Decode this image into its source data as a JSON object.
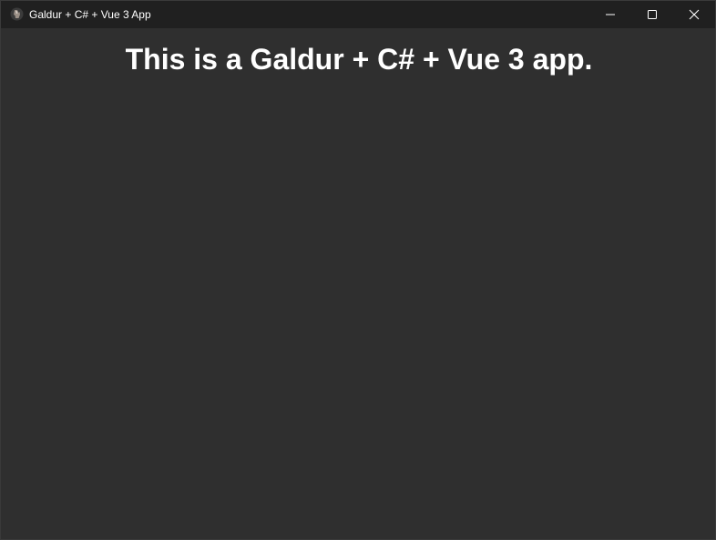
{
  "window": {
    "title": "Galdur + C# + Vue 3 App",
    "icon": "app-icon"
  },
  "title_controls": {
    "minimize": "minimize-icon",
    "maximize": "maximize-icon",
    "close": "close-icon"
  },
  "main": {
    "heading": "This is a Galdur + C# + Vue 3 app."
  },
  "colors": {
    "titlebar": "#202020",
    "background": "#2f2f2f",
    "text": "#ffffff"
  }
}
